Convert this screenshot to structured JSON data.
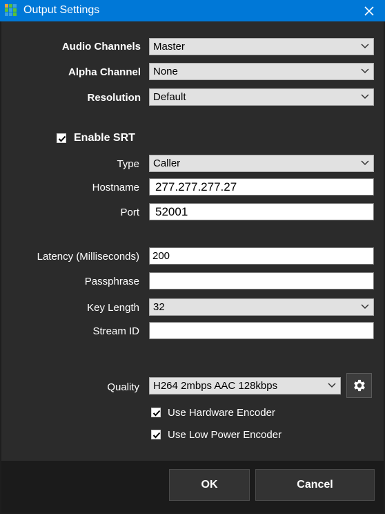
{
  "window": {
    "title": "Output Settings",
    "icon": "app-grid-icon",
    "close_icon": "close-icon"
  },
  "fields": {
    "audio_channels": {
      "label": "Audio Channels",
      "value": "Master"
    },
    "alpha_channel": {
      "label": "Alpha Channel",
      "value": "None"
    },
    "resolution": {
      "label": "Resolution",
      "value": "Default"
    },
    "enable_srt": {
      "label": "Enable SRT",
      "checked": true
    },
    "type": {
      "label": "Type",
      "value": "Caller"
    },
    "hostname": {
      "label": "Hostname",
      "value": "277.277.277.27"
    },
    "port": {
      "label": "Port",
      "value": "52001"
    },
    "latency": {
      "label": "Latency (Milliseconds)",
      "value": "200"
    },
    "passphrase": {
      "label": "Passphrase",
      "value": ""
    },
    "key_length": {
      "label": "Key Length",
      "value": "32"
    },
    "stream_id": {
      "label": "Stream ID",
      "value": ""
    },
    "quality": {
      "label": "Quality",
      "value": "H264 2mbps AAC 128kbps"
    },
    "use_hardware_encoder": {
      "label": "Use Hardware Encoder",
      "checked": true
    },
    "use_low_power_encoder": {
      "label": "Use Low Power Encoder",
      "checked": true
    }
  },
  "buttons": {
    "ok": "OK",
    "cancel": "Cancel",
    "gear_icon": "gear-icon"
  },
  "colors": {
    "titlebar": "#0078d7",
    "background": "#2b2b2b",
    "footer": "#1b1b1b"
  }
}
